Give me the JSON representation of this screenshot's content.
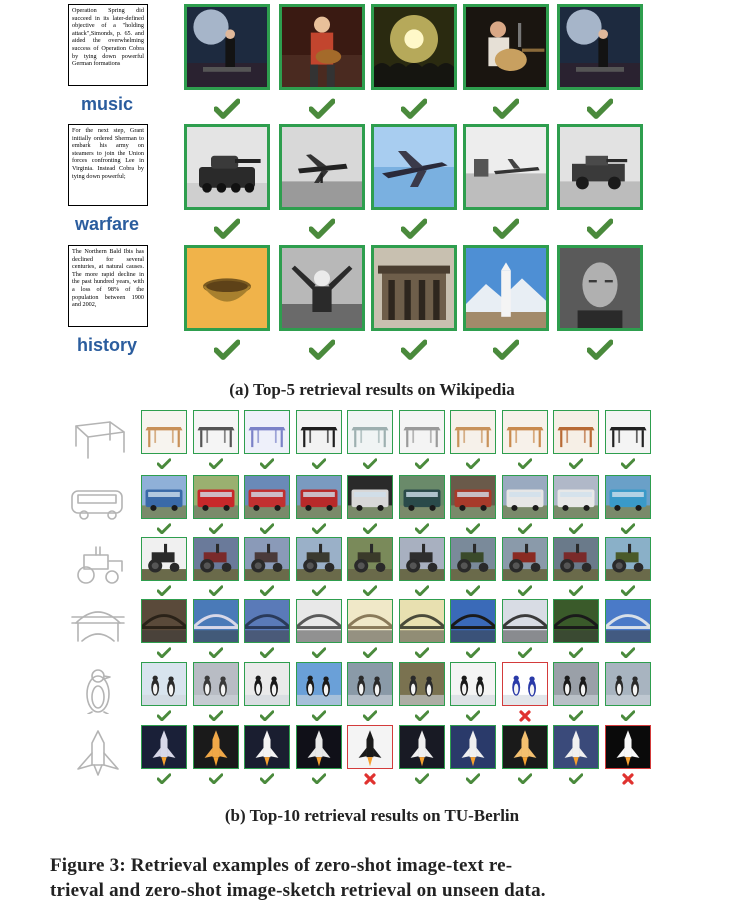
{
  "colors": {
    "check": "#4a8a3c",
    "cross": "#e0322f",
    "frame_ok": "#2e9e4e",
    "frame_bad": "#d33b3b",
    "category": "#2b5d9e"
  },
  "wikipedia": {
    "caption": "(a) Top-5 retrieval results on Wikipedia",
    "rows": [
      {
        "category": "music",
        "text": "Operation Spring did succeed in its later-defined objective of a \"holding attack\",Simonds, p. 65. and aided the overwhelming success of Operation Cobra by tying down powerful German formations",
        "thumbs": [
          "concert-stage",
          "guitarist-red",
          "crowd-lights",
          "acoustic-guitarist",
          "concert-stage"
        ],
        "results": [
          1,
          1,
          1,
          1,
          1
        ]
      },
      {
        "category": "warfare",
        "text": "For the next step, Grant initially ordered Sherman to embark his army on steamers to join the Union forces confronting Lee in Virginia. Instead Cobra by tying down powerful;",
        "thumbs": [
          "tank",
          "propeller-plane",
          "jet-aircraft",
          "airfield-bw",
          "armored-car"
        ],
        "results": [
          1,
          1,
          1,
          1,
          1
        ]
      },
      {
        "category": "history",
        "text": "The Northern Bald Ibis has declined for several centuries, at natural causes. The more rapid decline in the past hundred years, with a loss of 98% of the population between 1900 and 2002,",
        "thumbs": [
          "bronze-bowl",
          "cheering-man",
          "temple",
          "monument",
          "portrait"
        ],
        "results": [
          1,
          1,
          1,
          1,
          1
        ]
      }
    ]
  },
  "tuberlin": {
    "caption": "(b) Top-10 retrieval results on TU-Berlin",
    "rows": [
      {
        "sketch": "table-sketch-icon",
        "theme": "table",
        "results": [
          1,
          1,
          1,
          1,
          1,
          1,
          1,
          1,
          1,
          1
        ]
      },
      {
        "sketch": "bus-sketch-icon",
        "theme": "bus",
        "results": [
          1,
          1,
          1,
          1,
          1,
          1,
          1,
          1,
          1,
          1
        ]
      },
      {
        "sketch": "tractor-sketch-icon",
        "theme": "tractor",
        "results": [
          1,
          1,
          1,
          1,
          1,
          1,
          1,
          1,
          1,
          1
        ]
      },
      {
        "sketch": "bridge-sketch-icon",
        "theme": "bridge",
        "results": [
          1,
          1,
          1,
          1,
          1,
          1,
          1,
          1,
          1,
          1
        ]
      },
      {
        "sketch": "penguin-sketch-icon",
        "theme": "penguin",
        "results": [
          1,
          1,
          1,
          1,
          1,
          1,
          1,
          0,
          1,
          1
        ]
      },
      {
        "sketch": "shuttle-sketch-icon",
        "theme": "shuttle",
        "results": [
          1,
          1,
          1,
          1,
          0,
          1,
          1,
          1,
          1,
          0
        ]
      }
    ]
  },
  "figure_caption_line1": "Figure 3: Retrieval examples of zero-shot image-text re-",
  "figure_caption_line2": "trieval and zero-shot image-sketch retrieval on unseen data."
}
